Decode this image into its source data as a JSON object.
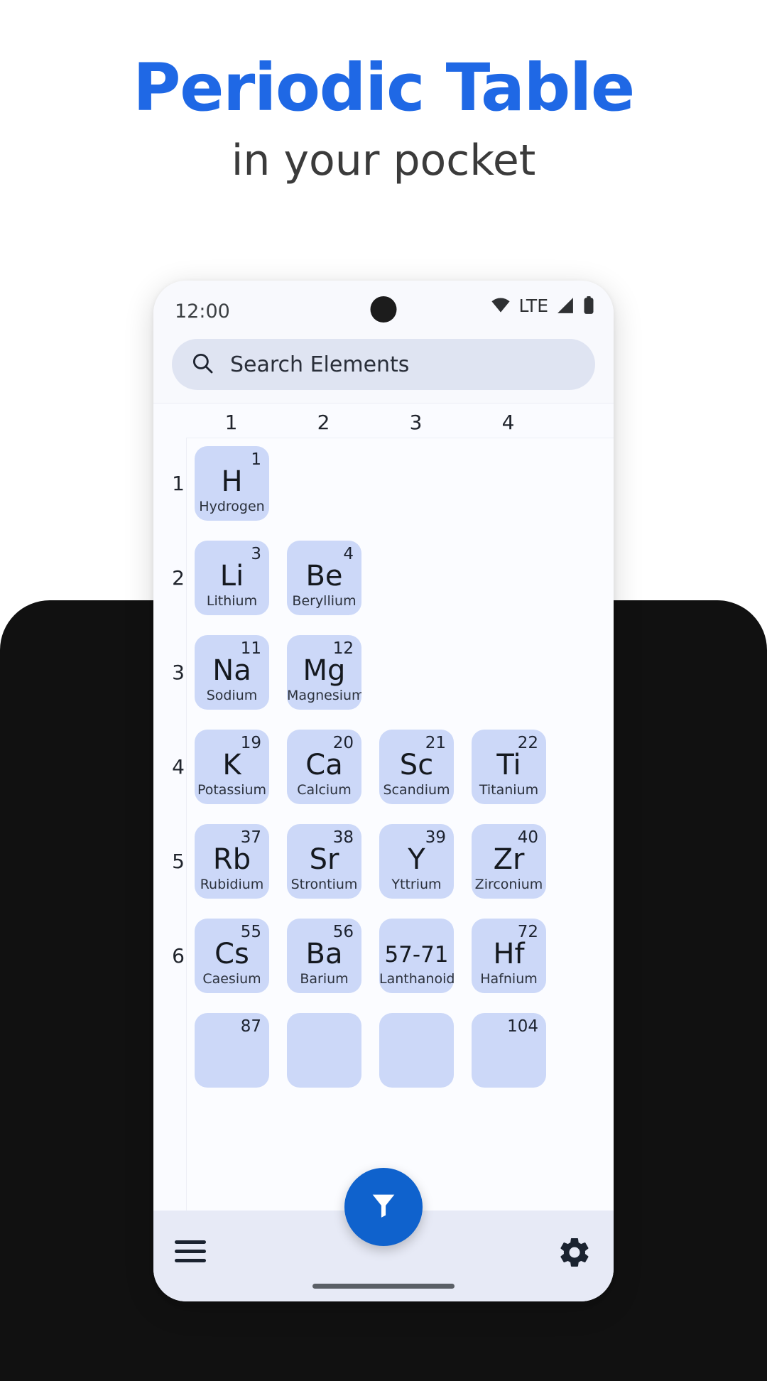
{
  "promo": {
    "title": "Periodic Table",
    "subtitle": "in your pocket",
    "title_color": "#1f68e5",
    "subtitle_color": "#3b3b3b"
  },
  "phone": {
    "status_bar": {
      "time": "12:00",
      "network_label": "LTE",
      "icons": [
        "wifi-icon",
        "signal-icon",
        "battery-icon"
      ]
    },
    "search": {
      "icon": "search-icon",
      "placeholder": "Search Elements",
      "value": ""
    },
    "bottom_bar": {
      "menu_icon": "hamburger-menu-icon",
      "settings_icon": "gear-icon",
      "fab_icon": "filter-funnel-icon",
      "fab_color": "#0f62cd"
    }
  },
  "table": {
    "cell_color": "#ccd8f8",
    "column_headers": [
      "1",
      "2",
      "3",
      "4"
    ],
    "row_headers": [
      "1",
      "2",
      "3",
      "4",
      "5",
      "6"
    ],
    "elements": [
      {
        "number": "1",
        "symbol": "H",
        "name": "Hydrogen",
        "group": 1,
        "period": 1
      },
      {
        "number": "3",
        "symbol": "Li",
        "name": "Lithium",
        "group": 1,
        "period": 2
      },
      {
        "number": "4",
        "symbol": "Be",
        "name": "Beryllium",
        "group": 2,
        "period": 2
      },
      {
        "number": "11",
        "symbol": "Na",
        "name": "Sodium",
        "group": 1,
        "period": 3
      },
      {
        "number": "12",
        "symbol": "Mg",
        "name": "Magnesium",
        "group": 2,
        "period": 3
      },
      {
        "number": "19",
        "symbol": "K",
        "name": "Potassium",
        "group": 1,
        "period": 4
      },
      {
        "number": "20",
        "symbol": "Ca",
        "name": "Calcium",
        "group": 2,
        "period": 4
      },
      {
        "number": "21",
        "symbol": "Sc",
        "name": "Scandium",
        "group": 3,
        "period": 4
      },
      {
        "number": "22",
        "symbol": "Ti",
        "name": "Titanium",
        "group": 4,
        "period": 4
      },
      {
        "number": "37",
        "symbol": "Rb",
        "name": "Rubidium",
        "group": 1,
        "period": 5
      },
      {
        "number": "38",
        "symbol": "Sr",
        "name": "Strontium",
        "group": 2,
        "period": 5
      },
      {
        "number": "39",
        "symbol": "Y",
        "name": "Yttrium",
        "group": 3,
        "period": 5
      },
      {
        "number": "40",
        "symbol": "Zr",
        "name": "Zirconium",
        "group": 4,
        "period": 5
      },
      {
        "number": "55",
        "symbol": "Cs",
        "name": "Caesium",
        "group": 1,
        "period": 6
      },
      {
        "number": "56",
        "symbol": "Ba",
        "name": "Barium",
        "group": 2,
        "period": 6
      },
      {
        "number": "",
        "symbol": "57-71",
        "name": "Lanthanoids",
        "group": 3,
        "period": 6
      },
      {
        "number": "72",
        "symbol": "Hf",
        "name": "Hafnium",
        "group": 4,
        "period": 6
      },
      {
        "number": "87",
        "symbol": "",
        "name": "",
        "group": 1,
        "period": 7
      },
      {
        "number": "",
        "symbol": "",
        "name": "",
        "group": 2,
        "period": 7
      },
      {
        "number": "",
        "symbol": "",
        "name": "",
        "group": 3,
        "period": 7
      },
      {
        "number": "104",
        "symbol": "",
        "name": "",
        "group": 4,
        "period": 7
      }
    ]
  }
}
